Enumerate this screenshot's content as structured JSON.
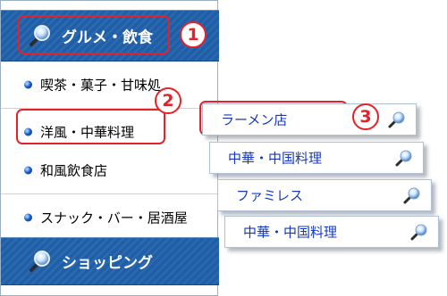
{
  "menu": {
    "gourmet_header": {
      "label": "グルメ・飲食",
      "icon": "magnifier-icon"
    },
    "items": [
      {
        "label": "喫茶・菓子・甘味処"
      },
      {
        "label": "洋風・中華料理"
      },
      {
        "label": "和風飲食店"
      },
      {
        "label": "スナック・バー・居酒屋"
      }
    ],
    "shopping_header": {
      "label": "ショッピング",
      "icon": "magnifier-icon"
    }
  },
  "submenu": [
    {
      "label": "ラーメン店",
      "icon": "magnifier-icon"
    },
    {
      "label": "中華・中国料理",
      "icon": "magnifier-icon"
    },
    {
      "label": "ファミレス",
      "icon": "magnifier-icon"
    },
    {
      "label": "中華・中国料理",
      "icon": "magnifier-icon"
    }
  ],
  "callouts": {
    "step1": "1",
    "step2": "2",
    "step3": "3"
  },
  "colors": {
    "header_blue": "#1f5fa8",
    "link_blue": "#1438c4",
    "callout_red": "#e3222a"
  }
}
